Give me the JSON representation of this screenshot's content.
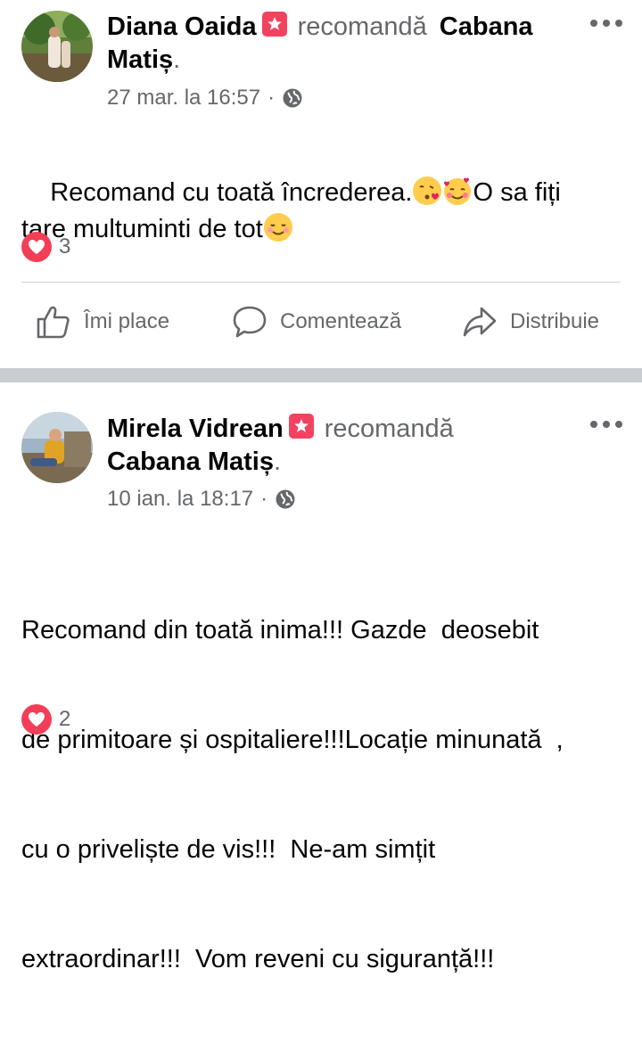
{
  "posts": [
    {
      "author": "Diana Oaida",
      "action": "recomandă",
      "page": "Cabana",
      "page_line2": "Matiș",
      "period": ".",
      "time": "27 mar. la 16:57",
      "separator": "·",
      "text_line1": "Recomand cu toată încrederea.",
      "text_after_emojis": "O sa fiți",
      "text_line2": "tare multuminti de tot",
      "reaction_count": "3",
      "emojis": [
        "kissing-heart-emoji",
        "smiling-hearts-emoji",
        "smiling-blush-emoji"
      ]
    },
    {
      "author": "Mirela Vidrean",
      "action": "recomandă",
      "page": "Cabana Matiș",
      "period": ".",
      "time": "10 ian. la 18:17",
      "separator": "·",
      "text_lines": [
        "Recomand din toată inima!!! Gazde  deosebit",
        "de primitoare și ospitaliere!!!Locație minunată  ,",
        "cu o priveliște de vis!!!  Ne-am simțit",
        "extraordinar!!!  Vom reveni cu siguranță!!!"
      ],
      "reaction_count": "2"
    }
  ],
  "actions": {
    "like": "Îmi place",
    "comment": "Comentează",
    "share": "Distribuie"
  },
  "colors": {
    "badge": "#f3425f",
    "heart": "#f33e58",
    "secondary_text": "#65676b",
    "divider": "#ced0d4",
    "section_gap": "#c9ccd1"
  }
}
